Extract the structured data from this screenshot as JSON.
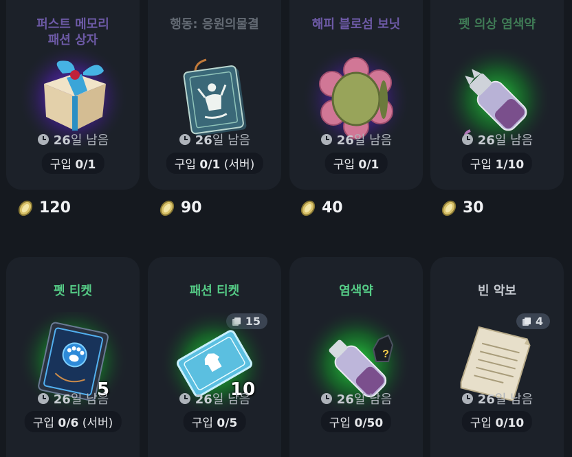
{
  "items": [
    {
      "title_line1": "퍼스트 메모리",
      "title_line2": "패션 상자",
      "timer_value": "26",
      "timer_suffix": "일 남음",
      "limit_label": "구입",
      "limit_value": "0/1",
      "limit_extra": "",
      "price": "120",
      "icon": "gift-box-icon"
    },
    {
      "title_line1": "행동: 응원의물결",
      "title_line2": "",
      "timer_value": "26",
      "timer_suffix": "일 남음",
      "limit_label": "구입",
      "limit_value": "0/1",
      "limit_extra": "(서버)",
      "price": "90",
      "icon": "action-card-icon"
    },
    {
      "title_line1": "해피 블로섬 보닛",
      "title_line2": "",
      "timer_value": "26",
      "timer_suffix": "일 남음",
      "limit_label": "구입",
      "limit_value": "0/1",
      "limit_extra": "",
      "price": "40",
      "icon": "flower-bonnet-icon"
    },
    {
      "title_line1": "펫 의상 염색약",
      "title_line2": "",
      "timer_value": "26",
      "timer_suffix": "일 남음",
      "limit_label": "구입",
      "limit_value": "1/10",
      "limit_extra": "",
      "price": "30",
      "icon": "pet-dye-icon"
    },
    {
      "title_line1": "펫 티켓",
      "title_line2": "",
      "timer_value": "26",
      "timer_suffix": "일 남음",
      "limit_label": "구입",
      "limit_value": "0/6",
      "limit_extra": "(서버)",
      "quantity": "5",
      "icon": "pet-ticket-icon"
    },
    {
      "title_line1": "패션 티켓",
      "title_line2": "",
      "timer_value": "26",
      "timer_suffix": "일 남음",
      "limit_label": "구입",
      "limit_value": "0/5",
      "limit_extra": "",
      "quantity": "10",
      "badge": "15",
      "icon": "fashion-ticket-icon"
    },
    {
      "title_line1": "염색약",
      "title_line2": "",
      "timer_value": "26",
      "timer_suffix": "일 남음",
      "limit_label": "구입",
      "limit_value": "0/50",
      "limit_extra": "",
      "icon": "dye-icon"
    },
    {
      "title_line1": "빈 악보",
      "title_line2": "",
      "timer_value": "26",
      "timer_suffix": "일 남음",
      "limit_label": "구입",
      "limit_value": "0/10",
      "limit_extra": "",
      "badge": "4",
      "icon": "blank-score-icon"
    }
  ],
  "colors": {
    "background": "#15191f",
    "card": "#1c2129",
    "accent_green": "#55cc86",
    "glow_purple": "#7a3cff",
    "glow_green": "#2fff4a"
  }
}
